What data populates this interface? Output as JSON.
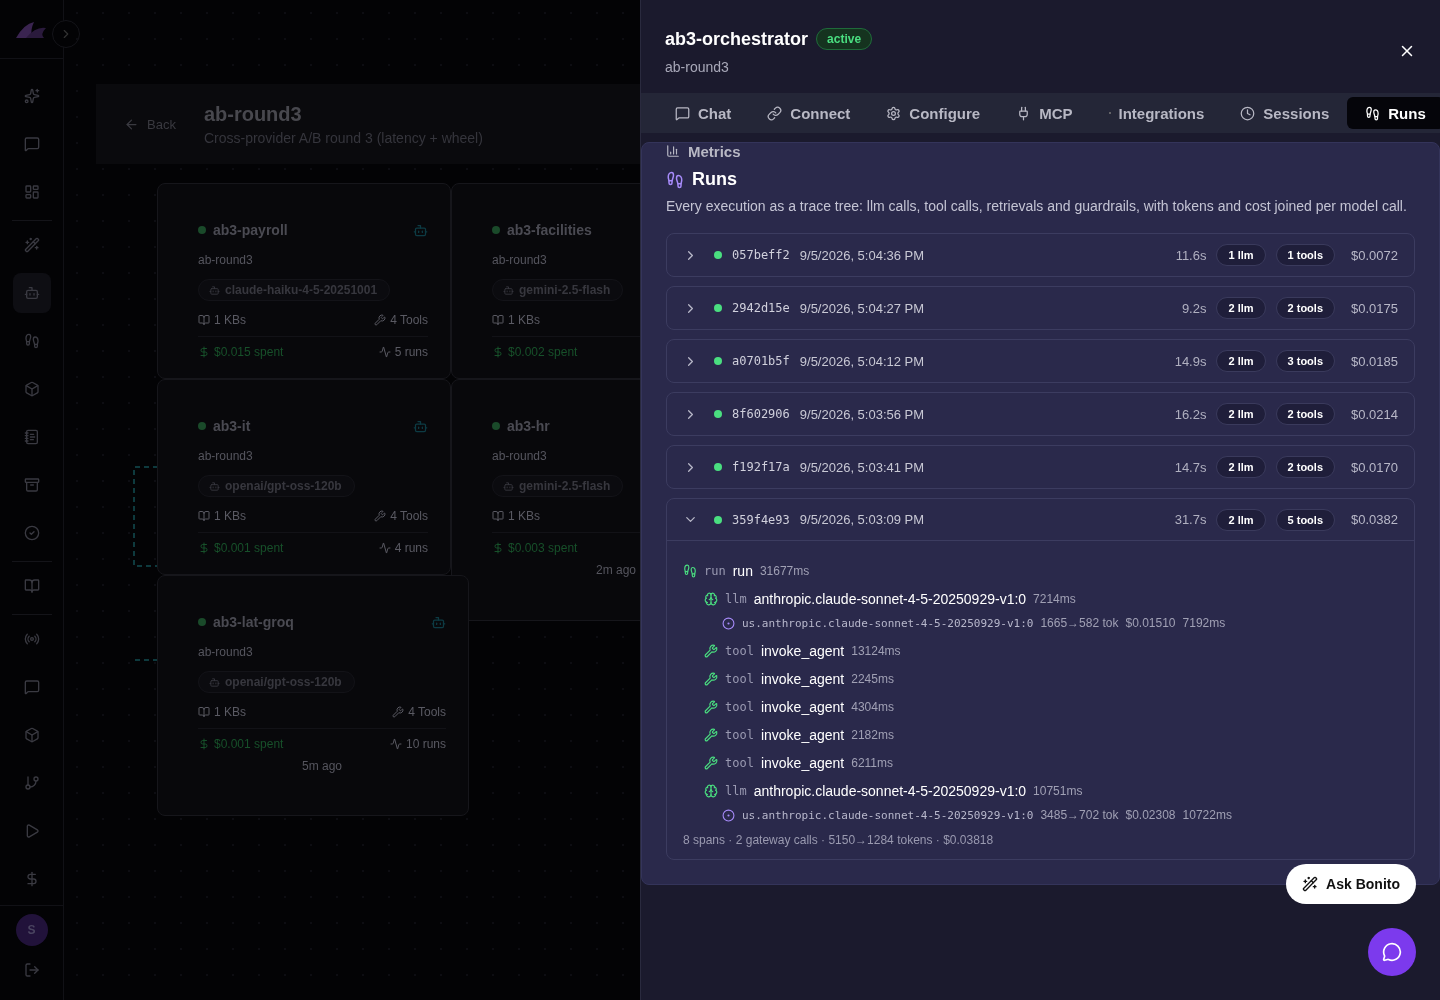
{
  "sidebar": {
    "items": [
      {
        "selected": false
      },
      {
        "selected": false
      },
      {
        "selected": false
      },
      {
        "selected": false
      },
      {
        "selected": true
      },
      {
        "selected": false
      },
      {
        "selected": false
      },
      {
        "selected": false
      },
      {
        "selected": false
      },
      {
        "selected": false
      },
      {
        "selected": false
      },
      {
        "selected": false
      },
      {
        "selected": false
      },
      {
        "selected": false
      },
      {
        "selected": false
      },
      {
        "selected": false
      },
      {
        "selected": false
      }
    ],
    "avatar": "S"
  },
  "header": {
    "back": "Back",
    "title": "ab-round3",
    "subtitle": "Cross-provider A/B round 3 (latency + wheel)"
  },
  "agents": [
    {
      "name": "ab3-payroll",
      "project": "ab-round3",
      "model": "claude-haiku-4-5-20251001",
      "kbs": "1 KBs",
      "tools": "4 Tools",
      "spent": "$0.015 spent",
      "runs": "5 runs"
    },
    {
      "name": "ab3-facilities",
      "project": "ab-round3",
      "model": "gemini-2.5-flash",
      "kbs": "1 KBs",
      "spent": "$0.002 spent"
    },
    {
      "name": "ab3-it",
      "project": "ab-round3",
      "model": "openai/gpt-oss-120b",
      "kbs": "1 KBs",
      "tools": "4 Tools",
      "spent": "$0.001 spent",
      "runs": "4 runs"
    },
    {
      "name": "ab3-hr",
      "project": "ab-round3",
      "model": "gemini-2.5-flash",
      "kbs": "1 KBs",
      "spent": "$0.003 spent",
      "ago": "2m ago"
    },
    {
      "name": "ab3-lat-groq",
      "project": "ab-round3",
      "model": "openai/gpt-oss-120b",
      "kbs": "1 KBs",
      "tools": "4 Tools",
      "spent": "$0.001 spent",
      "runs": "10 runs",
      "ago": "5m ago"
    }
  ],
  "drawer": {
    "title": "ab3-orchestrator",
    "status": "active",
    "subtitle": "ab-round3",
    "tabs": [
      {
        "label": "Chat",
        "selected": false
      },
      {
        "label": "Connect",
        "selected": false
      },
      {
        "label": "Configure",
        "selected": false
      },
      {
        "label": "MCP",
        "selected": false
      },
      {
        "label": "Integrations",
        "selected": false
      },
      {
        "label": "Sessions",
        "selected": false
      },
      {
        "label": "Runs",
        "selected": true
      },
      {
        "label": "Metrics",
        "selected": false
      }
    ],
    "section": {
      "title": "Runs",
      "description": "Every execution as a trace tree: llm calls, tool calls, retrievals and guardrails, with tokens and cost joined per model call."
    },
    "runs": [
      {
        "id": "057beff2",
        "time": "9/5/2026, 5:04:36 PM",
        "duration": "11.6s",
        "llm": "1 llm",
        "tools": "1 tools",
        "cost": "$0.0072",
        "expanded": false
      },
      {
        "id": "2942d15e",
        "time": "9/5/2026, 5:04:27 PM",
        "duration": "9.2s",
        "llm": "2 llm",
        "tools": "2 tools",
        "cost": "$0.0175",
        "expanded": false
      },
      {
        "id": "a0701b5f",
        "time": "9/5/2026, 5:04:12 PM",
        "duration": "14.9s",
        "llm": "2 llm",
        "tools": "3 tools",
        "cost": "$0.0185",
        "expanded": false
      },
      {
        "id": "8f602906",
        "time": "9/5/2026, 5:03:56 PM",
        "duration": "16.2s",
        "llm": "2 llm",
        "tools": "2 tools",
        "cost": "$0.0214",
        "expanded": false
      },
      {
        "id": "f192f17a",
        "time": "9/5/2026, 5:03:41 PM",
        "duration": "14.7s",
        "llm": "2 llm",
        "tools": "2 tools",
        "cost": "$0.0170",
        "expanded": false
      },
      {
        "id": "359f4e93",
        "time": "9/5/2026, 5:03:09 PM",
        "duration": "31.7s",
        "llm": "2 llm",
        "tools": "5 tools",
        "cost": "$0.0382",
        "expanded": true,
        "trace": {
          "kind": "run",
          "type": "run",
          "name": "run",
          "duration": "31677ms",
          "children": [
            {
              "kind": "llm",
              "type": "llm",
              "name": "anthropic.claude-sonnet-4-5-20250929-v1:0",
              "duration": "7214ms",
              "children": [
                {
                  "kind": "gateway",
                  "name": "us.anthropic.claude-sonnet-4-5-20250929-v1:0",
                  "tokens": "1665→582 tok",
                  "cost": "$0.01510",
                  "duration": "7192ms"
                }
              ]
            },
            {
              "kind": "tool",
              "type": "tool",
              "name": "invoke_agent",
              "duration": "13124ms"
            },
            {
              "kind": "tool",
              "type": "tool",
              "name": "invoke_agent",
              "duration": "2245ms"
            },
            {
              "kind": "tool",
              "type": "tool",
              "name": "invoke_agent",
              "duration": "4304ms"
            },
            {
              "kind": "tool",
              "type": "tool",
              "name": "invoke_agent",
              "duration": "2182ms"
            },
            {
              "kind": "tool",
              "type": "tool",
              "name": "invoke_agent",
              "duration": "6211ms"
            },
            {
              "kind": "llm",
              "type": "llm",
              "name": "anthropic.claude-sonnet-4-5-20250929-v1:0",
              "duration": "10751ms",
              "children": [
                {
                  "kind": "gateway",
                  "name": "us.anthropic.claude-sonnet-4-5-20250929-v1:0",
                  "tokens": "3485→702 tok",
                  "cost": "$0.02308",
                  "duration": "10722ms"
                }
              ]
            }
          ]
        },
        "summary": "8 spans · 2 gateway calls · 5150→1284 tokens · $0.03818"
      }
    ]
  },
  "assistant": {
    "label": "Ask Bonito"
  }
}
